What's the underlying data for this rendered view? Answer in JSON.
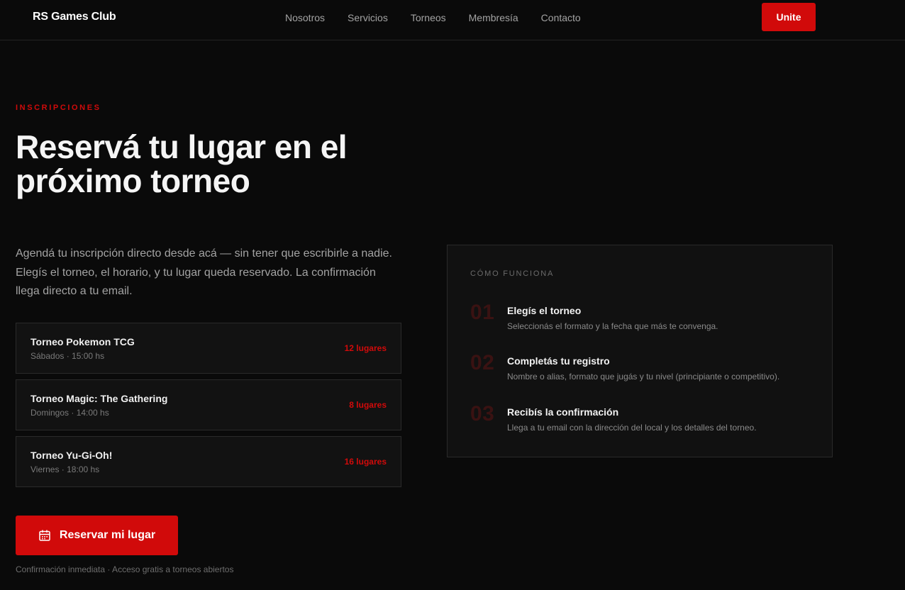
{
  "header": {
    "brand": "RS Games Club",
    "nav": [
      "Nosotros",
      "Servicios",
      "Torneos",
      "Membresía",
      "Contacto"
    ],
    "cta": "Unite"
  },
  "hero": {
    "eyebrow": "INSCRIPCIONES",
    "title": "Reservá tu lugar en el próximo torneo",
    "lead": "Agendá tu inscripción directo desde acá — sin tener que escribirle a nadie. Elegís el torneo, el horario, y tu lugar queda reservado. La confirmación llega directo a tu email."
  },
  "tournaments": [
    {
      "name": "Torneo Pokemon TCG",
      "schedule": "Sábados · 15:00 hs",
      "spots": "12 lugares"
    },
    {
      "name": "Torneo Magic: The Gathering",
      "schedule": "Domingos · 14:00 hs",
      "spots": "8 lugares"
    },
    {
      "name": "Torneo Yu-Gi-Oh!",
      "schedule": "Viernes · 18:00 hs",
      "spots": "16 lugares"
    }
  ],
  "reserve": {
    "label": "Reservar mi lugar",
    "icon": "calendar-icon",
    "note": "Confirmación inmediata · Acceso gratis a torneos abiertos"
  },
  "how": {
    "title": "CÓMO FUNCIONA",
    "steps": [
      {
        "num": "01",
        "title": "Elegís el torneo",
        "desc": "Seleccionás el formato y la fecha que más te convenga."
      },
      {
        "num": "02",
        "title": "Completás tu registro",
        "desc": "Nombre o alias, formato que jugás y tu nivel (principiante o competitivo)."
      },
      {
        "num": "03",
        "title": "Recibís la confirmación",
        "desc": "Llega a tu email con la dirección del local y los detalles del torneo."
      }
    ]
  },
  "colors": {
    "accent": "#d10a0a",
    "background": "#0a0a0a",
    "panel": "#111111"
  }
}
